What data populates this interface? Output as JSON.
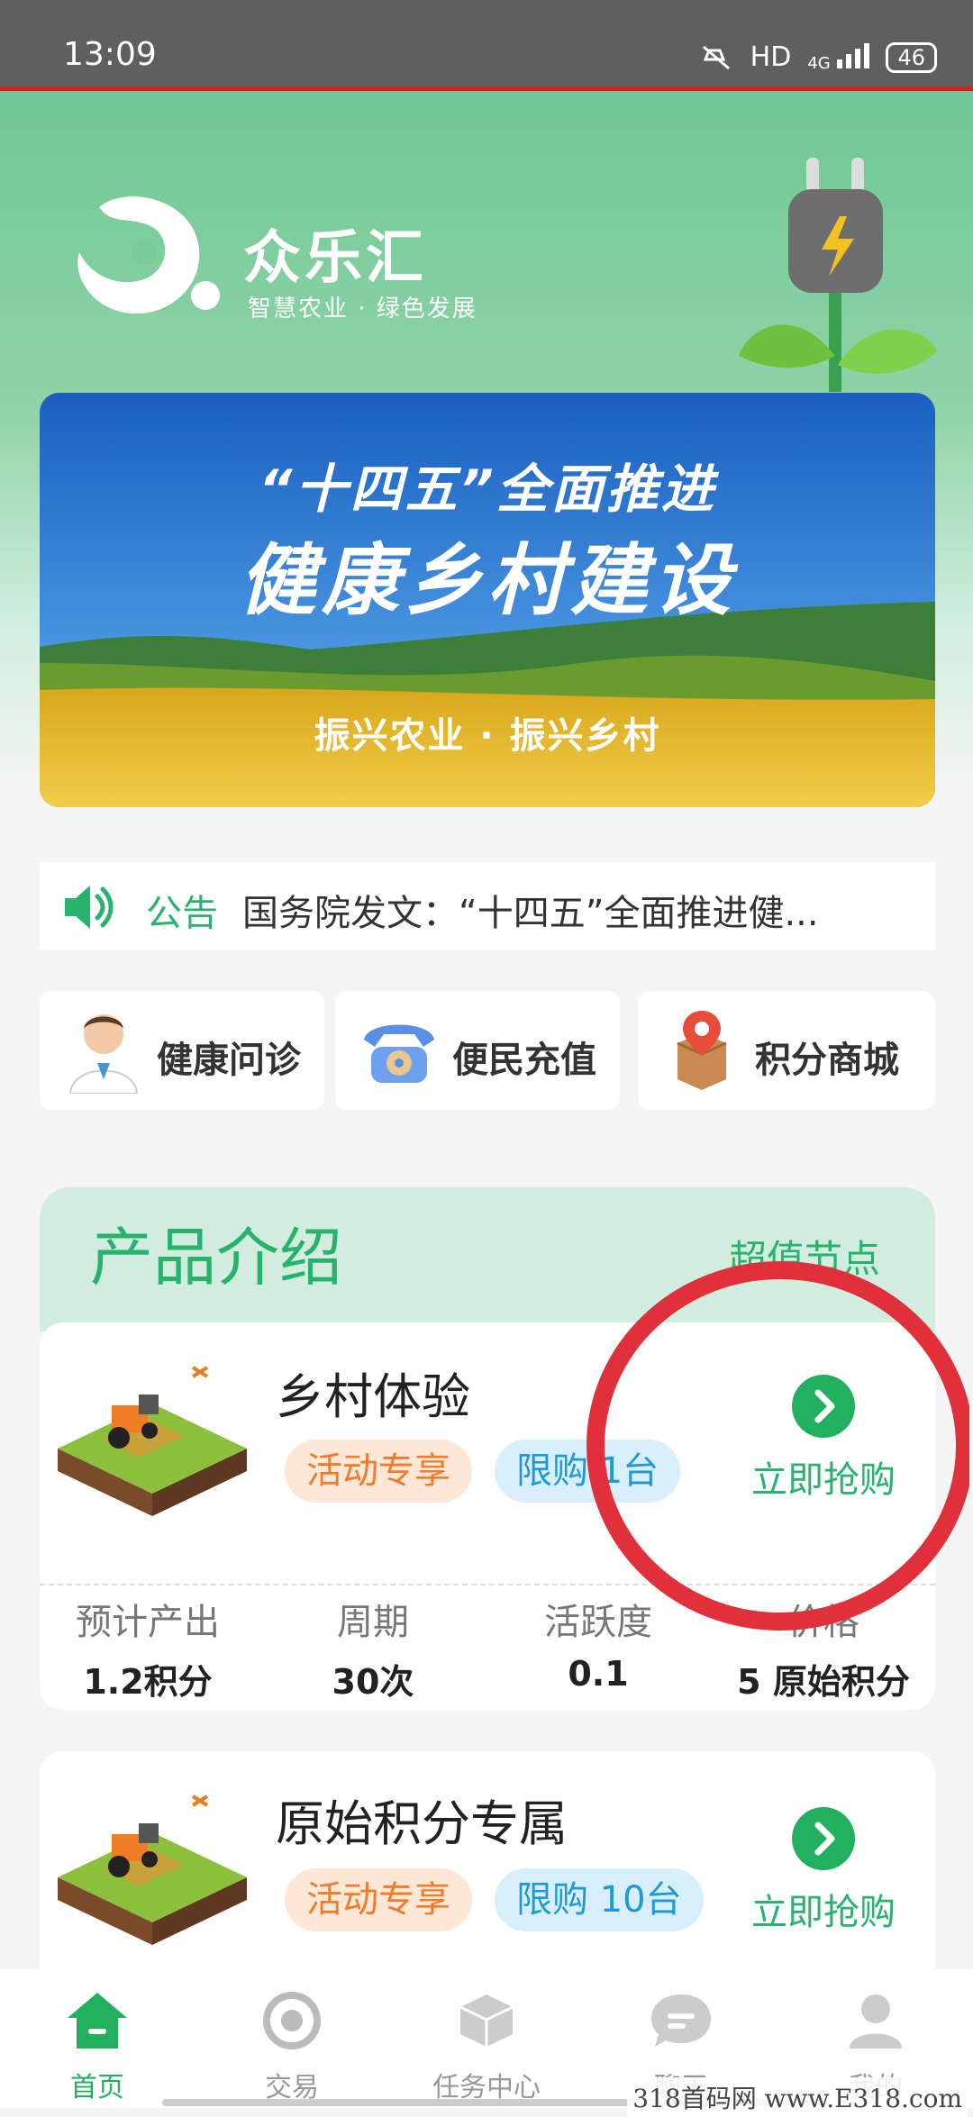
{
  "status_bar": {
    "time": "13:09",
    "network": "HD",
    "signal": "4G",
    "battery": "46"
  },
  "brand": {
    "name": "众乐汇",
    "slogan": "智慧农业 · 绿色发展"
  },
  "banner": {
    "line1": "“十四五”全面推进",
    "line2": "健康乡村建设",
    "line3": "振兴农业 · 振兴乡村"
  },
  "notice": {
    "label": "公告",
    "text": "国务院发文：“十四五”全面推进健..."
  },
  "quick_entries": [
    {
      "label": "健康问诊",
      "icon": "doctor-icon"
    },
    {
      "label": "便民充值",
      "icon": "telephone-icon"
    },
    {
      "label": "积分商城",
      "icon": "shop-package-icon"
    }
  ],
  "products_section": {
    "title": "产品介绍",
    "link": "超值节点"
  },
  "products": [
    {
      "name": "乡村体验",
      "tags": [
        "活动专享",
        "限购 1台"
      ],
      "buy_label": "立即抢购",
      "stats": [
        {
          "label": "预计产出",
          "value": "1.2积分"
        },
        {
          "label": "周期",
          "value": "30次"
        },
        {
          "label": "活跃度",
          "value": "0.1"
        },
        {
          "label": "价格",
          "value": "5 原始积分"
        }
      ]
    },
    {
      "name": "原始积分专属",
      "tags": [
        "活动专享",
        "限购 10台"
      ],
      "buy_label": "立即抢购"
    }
  ],
  "tabs": [
    {
      "label": "首页",
      "icon": "home-icon",
      "active": true
    },
    {
      "label": "交易",
      "icon": "exchange-icon",
      "active": false
    },
    {
      "label": "任务中心",
      "icon": "task-cube-icon",
      "active": false
    },
    {
      "label": "聊天",
      "icon": "chat-icon",
      "active": false
    },
    {
      "label": "我的",
      "icon": "profile-icon",
      "active": false
    }
  ],
  "watermark": "318首码网 www.E318.com",
  "colors": {
    "accent": "#22b05f",
    "annotation": "#e0303a"
  }
}
